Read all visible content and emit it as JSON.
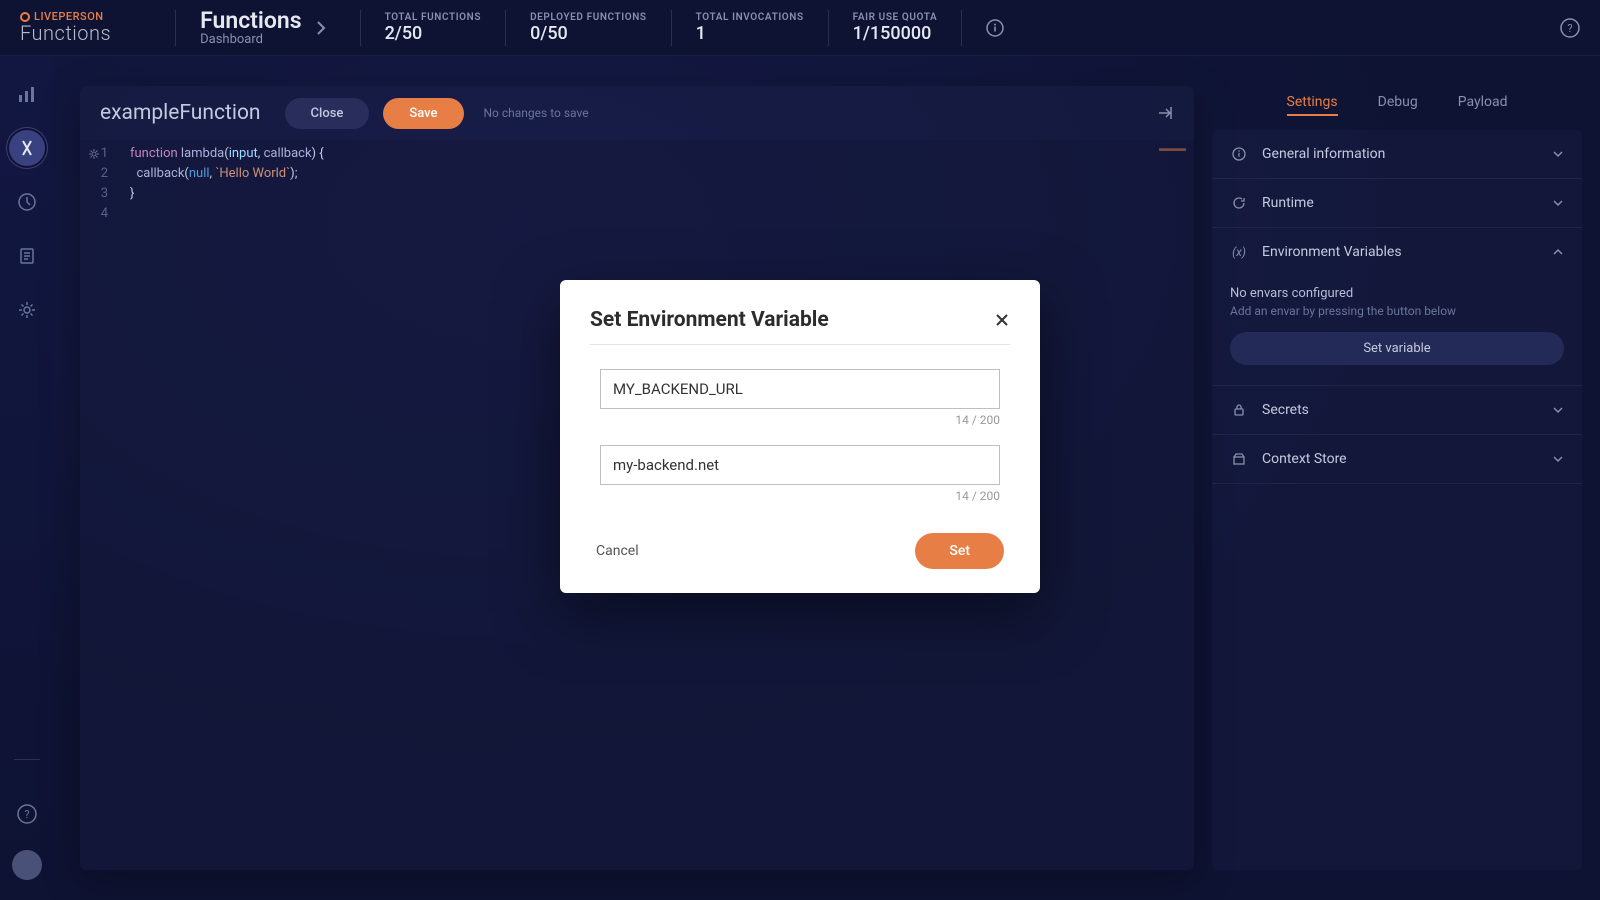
{
  "brand": {
    "top": "LIVEPERSON",
    "bottom": "Functions"
  },
  "breadcrumb": {
    "title": "Functions",
    "subtitle": "Dashboard"
  },
  "stats": [
    {
      "label": "TOTAL FUNCTIONS",
      "value": "2/50"
    },
    {
      "label": "DEPLOYED FUNCTIONS",
      "value": "0/50"
    },
    {
      "label": "TOTAL INVOCATIONS",
      "value": "1"
    },
    {
      "label": "FAIR USE QUOTA",
      "value": "1/150000"
    }
  ],
  "editor": {
    "functionName": "exampleFunction",
    "closeLabel": "Close",
    "saveLabel": "Save",
    "noChanges": "No changes to save",
    "code": {
      "line1": {
        "kw": "function",
        "name": "lambda",
        "p1": "input",
        "p2": "callback"
      },
      "line2": {
        "call": "callback",
        "null": "null",
        "str": "`Hello World`"
      }
    }
  },
  "rightPanel": {
    "tabs": {
      "settings": "Settings",
      "debug": "Debug",
      "payload": "Payload"
    },
    "sections": {
      "general": "General information",
      "runtime": "Runtime",
      "envvars": "Environment Variables",
      "secrets": "Secrets",
      "context": "Context Store"
    },
    "envEmpty": {
      "title": "No envars configured",
      "subtitle": "Add an envar by pressing the button below",
      "buttonLabel": "Set variable"
    }
  },
  "modal": {
    "title": "Set Environment Variable",
    "keyValue": "MY_BACKEND_URL",
    "keyCounter": "14 / 200",
    "valValue": "my-backend.net",
    "valCounter": "14 / 200",
    "cancelLabel": "Cancel",
    "setLabel": "Set"
  }
}
